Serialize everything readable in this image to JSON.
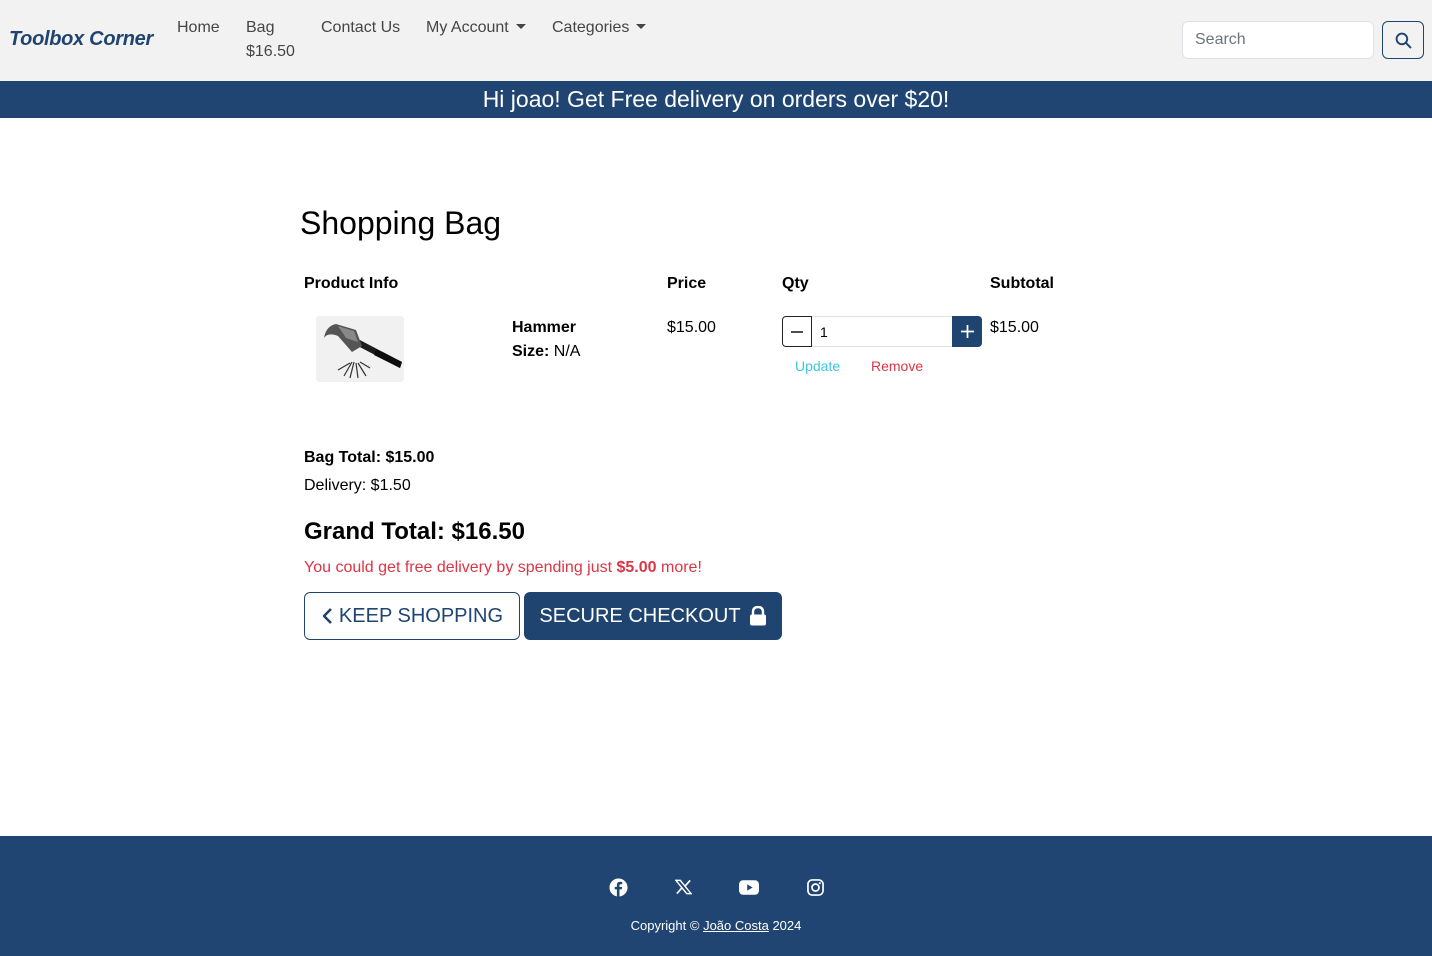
{
  "navbar": {
    "brand": "Toolbox Corner",
    "home": "Home",
    "bag_label": "Bag",
    "bag_total": "$16.50",
    "contact": "Contact Us",
    "my_account": "My Account",
    "categories": "Categories",
    "search_placeholder": "Search",
    "search_icon": "search-icon"
  },
  "banner": {
    "text": "Hi joao! Get Free delivery on orders over $20!"
  },
  "bag": {
    "title": "Shopping Bag",
    "columns": [
      "Product Info",
      "Price",
      "Qty",
      "Subtotal"
    ],
    "items": [
      {
        "name": "Hammer",
        "size_label": "Size:",
        "size_value": "N/A",
        "price": "$15.00",
        "qty": "1",
        "subtotal": "$15.00",
        "update_label": "Update",
        "remove_label": "Remove"
      }
    ],
    "bag_total": "Bag Total: $15.00",
    "delivery": "Delivery: $1.50",
    "grand_total": "Grand Total: $16.50",
    "free_msg_pre": "You could get free delivery by spending just ",
    "free_msg_amount": "$5.00",
    "free_msg_post": " more!",
    "keep_shopping": "KEEP SHOPPING",
    "secure_checkout": "SECURE CHECKOUT"
  },
  "footer": {
    "social": [
      "facebook-icon",
      "x-icon",
      "youtube-icon",
      "instagram-icon"
    ],
    "copyright_pre": "Copyright © ",
    "author": "João Costa",
    "copyright_post": " 2024"
  },
  "colors": {
    "primary": "#1f4470",
    "banner": "#204572",
    "danger": "#dc3545",
    "info": "#3ec6e0",
    "navbar_bg": "#f2f2f2"
  }
}
